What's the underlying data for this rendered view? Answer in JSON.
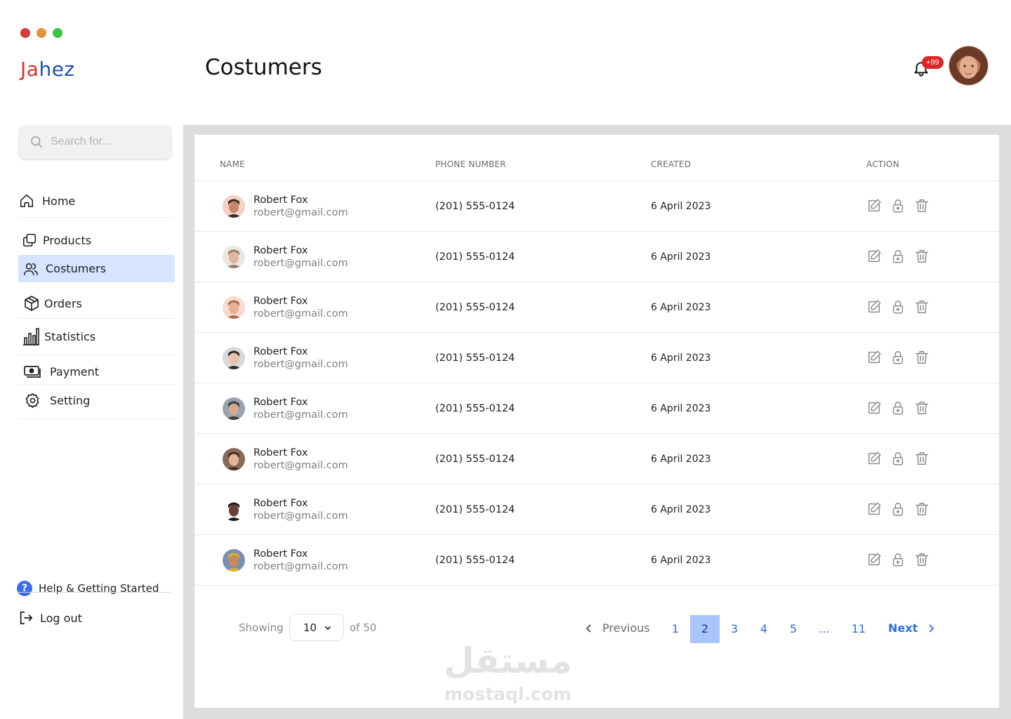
{
  "window_controls": {
    "close_color": "#d33c35",
    "minimize_color": "#e09440",
    "zoom_color": "#3ec344"
  },
  "brand": {
    "letters": [
      {
        "char": "J",
        "color": "#d6322b"
      },
      {
        "char": "a",
        "color": "#d6322b"
      },
      {
        "char": "h",
        "color": "#1b4fb5"
      },
      {
        "char": "e",
        "color": "#1b4fb5"
      },
      {
        "char": "z",
        "color": "#1b4fb5"
      }
    ]
  },
  "header": {
    "title": "Costumers",
    "notification_badge": "+99",
    "bell_icon": "bell-icon",
    "avatar_icon": "user-avatar"
  },
  "sidebar": {
    "search_placeholder": "Search for...",
    "items": [
      {
        "label": "Home",
        "icon": "home-icon",
        "active": false
      },
      {
        "label": "Products",
        "icon": "products-icon",
        "active": false
      },
      {
        "label": "Costumers",
        "icon": "users-icon",
        "active": true
      },
      {
        "label": "Orders",
        "icon": "box-icon",
        "active": false
      },
      {
        "label": "Statistics",
        "icon": "chart-icon",
        "active": false
      },
      {
        "label": "Payment",
        "icon": "payment-icon",
        "active": false
      },
      {
        "label": "Setting",
        "icon": "gear-icon",
        "active": false
      }
    ],
    "help_label": "Help & Getting Started",
    "logout_label": "Log out"
  },
  "table": {
    "columns": [
      "NAME",
      "PHONE NUMBER",
      "CREATED",
      "ACTION"
    ],
    "rows": [
      {
        "name": "Robert Fox",
        "email": "robert@gmail.com",
        "phone": "(201) 555-0124",
        "created": "6 April 2023"
      },
      {
        "name": "Robert Fox",
        "email": "robert@gmail.com",
        "phone": "(201) 555-0124",
        "created": "6 April 2023"
      },
      {
        "name": "Robert Fox",
        "email": "robert@gmail.com",
        "phone": "(201) 555-0124",
        "created": "6 April 2023"
      },
      {
        "name": "Robert Fox",
        "email": "robert@gmail.com",
        "phone": "(201) 555-0124",
        "created": "6 April 2023"
      },
      {
        "name": "Robert Fox",
        "email": "robert@gmail.com",
        "phone": "(201) 555-0124",
        "created": "6 April 2023"
      },
      {
        "name": "Robert Fox",
        "email": "robert@gmail.com",
        "phone": "(201) 555-0124",
        "created": "6 April 2023"
      },
      {
        "name": "Robert Fox",
        "email": "robert@gmail.com",
        "phone": "(201) 555-0124",
        "created": "6 April 2023"
      },
      {
        "name": "Robert Fox",
        "email": "robert@gmail.com",
        "phone": "(201) 555-0124",
        "created": "6 April 2023"
      }
    ],
    "action_icons": [
      "edit-icon",
      "lock-icon",
      "trash-icon"
    ]
  },
  "pagination": {
    "showing_label": "Showing",
    "per_page": "10",
    "of_label": "of 50",
    "previous_label": "Previous",
    "next_label": "Next",
    "pages": [
      "1",
      "2",
      "3",
      "4",
      "5",
      "...",
      "11"
    ],
    "current_page": "2"
  },
  "colors": {
    "accent": "#2f6fe4",
    "active_nav_bg": "#d6e4ff",
    "active_page_bg": "#a9c6fa",
    "badge_red": "#e02424"
  },
  "watermark": {
    "arabic": "مستقل",
    "latin": "mostaql.com"
  }
}
